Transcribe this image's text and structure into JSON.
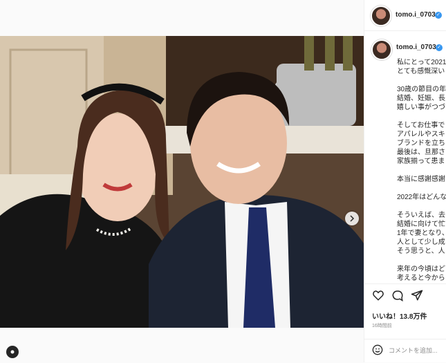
{
  "post": {
    "author": {
      "username": "tomo.i_0703",
      "verified": true
    },
    "caption_lines": [
      "私にとって2021",
      "とても感慨深い",
      "",
      "30歳の節目の年",
      "結婚、妊娠、長",
      "嬉しい事がつづ",
      "",
      "そしてお仕事で",
      "アパレルやスキ",
      "ブランドを立ち",
      "最後は、旦那さ",
      "家族揃って患ま",
      "",
      "本当に感謝感謝",
      "",
      "2022年はどんな",
      "",
      "そういえば、去",
      "結婚に向けて忙",
      "1年で妻となり、",
      "人として少し成",
      "そう思うと、人",
      "",
      "来年の今頃はど",
      "考えると今から"
    ],
    "likes": "いいね！13.8万件",
    "time_ago": "16時間前",
    "comment_placeholder": "コメントを追加..."
  },
  "icons": {
    "verified": "verified-badge-icon",
    "heart": "heart-icon",
    "comment": "comment-icon",
    "share": "paper-plane-icon",
    "emoji": "emoji-icon",
    "next": "chevron-right-icon"
  },
  "colors": {
    "verified_blue": "#3897f0",
    "border": "#efefef",
    "muted_text": "#8e8e8e"
  }
}
